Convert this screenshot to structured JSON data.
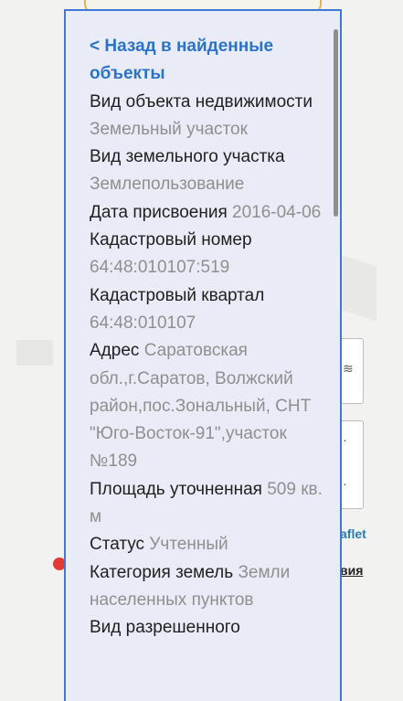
{
  "map": {
    "attribution": "aflet",
    "link_fragment": "вия"
  },
  "panel": {
    "back_link": "< Назад в найденные объекты",
    "fields": [
      {
        "label": "Вид объекта недвижимости",
        "value": "Земельный участок"
      },
      {
        "label": "Вид земельного участка",
        "value": "Землепользование"
      },
      {
        "label": "Дата присвоения",
        "value": "2016-04-06"
      },
      {
        "label": "Кадастровый номер",
        "value": "64:48:010107:519"
      },
      {
        "label": "Кадастровый квартал",
        "value": "64:48:010107"
      },
      {
        "label": "Адрес",
        "value": "Саратовская обл.,г.Саратов, Волжский район,пос.Зональный, СНТ \"Юго-Восток-91\",участок №189"
      },
      {
        "label": "Площадь уточненная",
        "value": "509 кв. м"
      },
      {
        "label": "Статус",
        "value": "Учтенный"
      },
      {
        "label": "Категория земель",
        "value": "Земли населенных пунктов"
      },
      {
        "label": "Вид разрешенного",
        "value": ""
      }
    ]
  }
}
